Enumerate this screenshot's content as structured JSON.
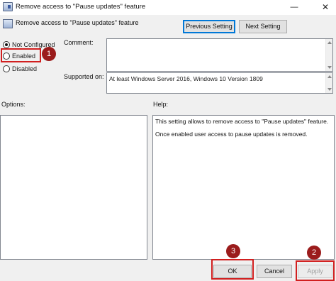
{
  "window": {
    "title": "Remove access to \"Pause updates\" feature",
    "minimize_glyph": "—",
    "close_glyph": "✕"
  },
  "header": {
    "policy_name": "Remove access to \"Pause updates\" feature",
    "prev_button": "Previous Setting",
    "next_button": "Next Setting"
  },
  "state_options": {
    "selected": "Not Configured",
    "items": [
      {
        "label": "Not Configured",
        "checked": true
      },
      {
        "label": "Enabled",
        "checked": false
      },
      {
        "label": "Disabled",
        "checked": false
      }
    ]
  },
  "fields": {
    "comment_label": "Comment:",
    "comment_value": "",
    "supported_label": "Supported on:",
    "supported_value": "At least Windows Server 2016, Windows 10 Version 1809"
  },
  "panes": {
    "options_label": "Options:",
    "help_label": "Help:",
    "help_text": [
      "This setting allows to remove access to \"Pause updates\" feature.",
      "Once enabled user access to pause updates is removed."
    ]
  },
  "footer": {
    "ok": "OK",
    "cancel": "Cancel",
    "apply": "Apply"
  },
  "annotations": {
    "badge_1": "1",
    "badge_2": "2",
    "badge_3": "3",
    "highlight_color": "#d11f1f",
    "badge_color": "#9b1c1c"
  }
}
